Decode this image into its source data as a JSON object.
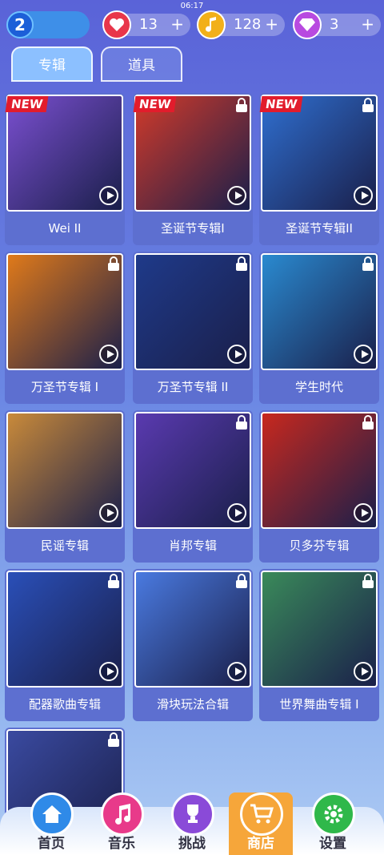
{
  "status": {
    "time": "06:17"
  },
  "topbar": {
    "level": "2",
    "hearts": {
      "value": "13",
      "plus": "+"
    },
    "notes": {
      "value": "128",
      "plus": "+"
    },
    "gems": {
      "value": "3",
      "plus": "+"
    }
  },
  "tabs": [
    {
      "label": "专辑",
      "active": true
    },
    {
      "label": "道具",
      "active": false
    }
  ],
  "albums": [
    {
      "title": "Wei II",
      "new": "NEW",
      "locked": false,
      "color": "#7a4fd0"
    },
    {
      "title": "圣诞节专辑I",
      "new": "NEW",
      "locked": true,
      "color": "#d23a2a"
    },
    {
      "title": "圣诞节专辑II",
      "new": "NEW",
      "locked": true,
      "color": "#2f6fd0"
    },
    {
      "title": "万圣节专辑 I",
      "new": "",
      "locked": true,
      "color": "#e07a1a"
    },
    {
      "title": "万圣节专辑 II",
      "new": "",
      "locked": true,
      "color": "#1f3a8a"
    },
    {
      "title": "学生时代",
      "new": "",
      "locked": true,
      "color": "#2a8ad0"
    },
    {
      "title": "民谣专辑",
      "new": "",
      "locked": false,
      "color": "#c98a3a"
    },
    {
      "title": "肖邦专辑",
      "new": "",
      "locked": true,
      "color": "#5a3ab0"
    },
    {
      "title": "贝多芬专辑",
      "new": "",
      "locked": true,
      "color": "#c8281e"
    },
    {
      "title": "配器歌曲专辑",
      "new": "",
      "locked": true,
      "color": "#2a4fb8"
    },
    {
      "title": "滑块玩法合辑",
      "new": "",
      "locked": true,
      "color": "#4a7ae0"
    },
    {
      "title": "世界舞曲专辑 I",
      "new": "",
      "locked": true,
      "color": "#3a8a5a"
    },
    {
      "title": "",
      "new": "",
      "locked": true,
      "color": "#3a4aa0"
    }
  ],
  "nav": [
    {
      "label": "首页",
      "icon": "home-icon",
      "color": "#2f8ae8"
    },
    {
      "label": "音乐",
      "icon": "music-icon",
      "color": "#e83a8a"
    },
    {
      "label": "挑战",
      "icon": "trophy-icon",
      "color": "#8a4ad8"
    },
    {
      "label": "商店",
      "icon": "cart-icon",
      "color": "#f6a63a",
      "active": true
    },
    {
      "label": "设置",
      "icon": "gear-icon",
      "color": "#2fb84a"
    }
  ]
}
